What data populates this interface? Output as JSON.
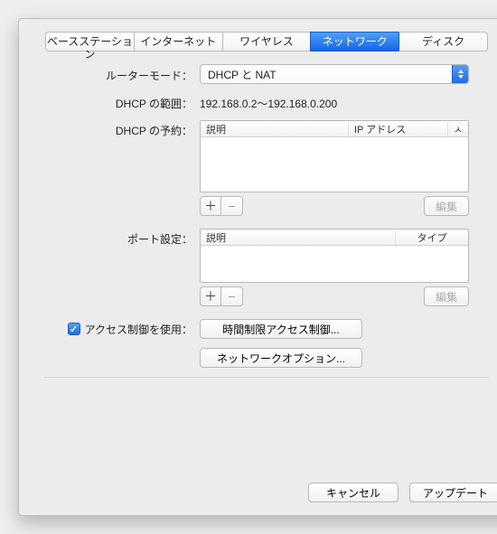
{
  "tabs": {
    "items": [
      "ベースステーション",
      "インターネット",
      "ワイヤレス",
      "ネットワーク",
      "ディスク"
    ],
    "selected_index": 3
  },
  "router_mode": {
    "label": "ルーターモード：",
    "value": "DHCP と NAT"
  },
  "dhcp_range": {
    "label": "DHCP の範囲：",
    "value": "192.168.0.2～192.168.0.200"
  },
  "dhcp_reserve": {
    "label": "DHCP の予約：",
    "columns": {
      "desc": "説明",
      "ip": "IP アドレス",
      "arrow": "ㅅ"
    },
    "add": "＋",
    "remove": "−",
    "edit": "編集"
  },
  "port_settings": {
    "label": "ポート設定：",
    "columns": {
      "desc": "説明",
      "type": "タイプ"
    },
    "add": "＋",
    "remove": "−",
    "edit": "編集"
  },
  "access_control": {
    "label": "アクセス制御を使用：",
    "button": "時間制限アクセス制御...",
    "checked": true
  },
  "network_options": {
    "button": "ネットワークオプション..."
  },
  "footer": {
    "cancel": "キャンセル",
    "update": "アップデート"
  }
}
